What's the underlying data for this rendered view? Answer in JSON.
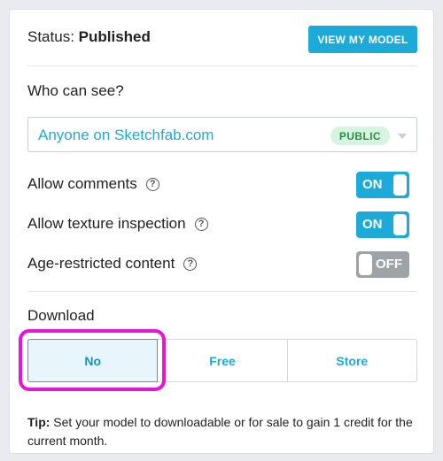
{
  "status": {
    "label": "Status:",
    "value": "Published",
    "view_button": "VIEW MY MODEL"
  },
  "visibility": {
    "heading": "Who can see?",
    "selected": "Anyone on Sketchfab.com",
    "badge": "PUBLIC"
  },
  "options": [
    {
      "label": "Allow comments",
      "state": "ON",
      "enabled": true
    },
    {
      "label": "Allow texture inspection",
      "state": "ON",
      "enabled": true
    },
    {
      "label": "Age-restricted content",
      "state": "OFF",
      "enabled": false
    }
  ],
  "download": {
    "heading": "Download",
    "choices": [
      "No",
      "Free",
      "Store"
    ],
    "selected": "No"
  },
  "tip": {
    "label": "Tip:",
    "text": "Set your model to downloadable or for sale to gain 1 credit for the current month."
  },
  "colors": {
    "accent": "#1caad9",
    "highlight": "#e516d6",
    "badge_bg": "#d6f5de",
    "toggle_off": "#9ea3a8"
  }
}
